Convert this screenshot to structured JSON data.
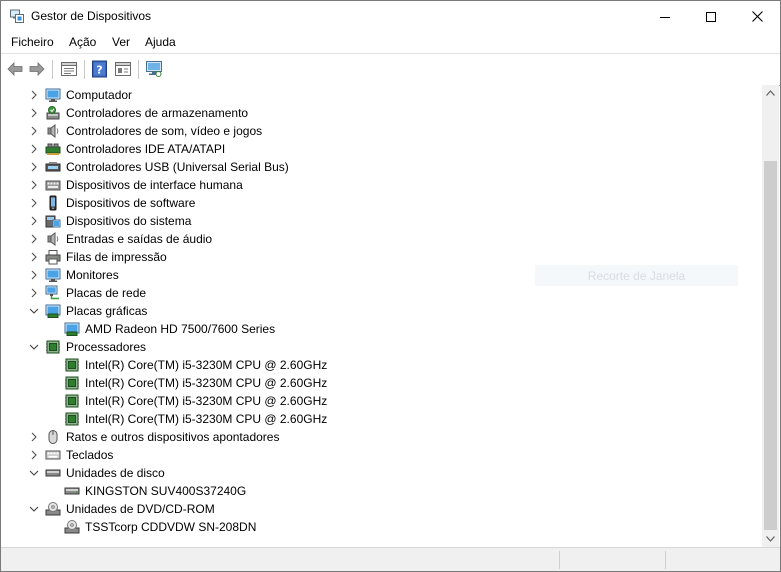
{
  "window": {
    "title": "Gestor de Dispositivos"
  },
  "menu": [
    "Ficheiro",
    "Ação",
    "Ver",
    "Ajuda"
  ],
  "tree": [
    {
      "label": "Computador",
      "icon": "monitor-icon",
      "state": "collapsed",
      "level": 0
    },
    {
      "label": "Controladores de armazenamento",
      "icon": "storage-controller-icon",
      "state": "collapsed",
      "level": 0
    },
    {
      "label": "Controladores de som, vídeo e jogos",
      "icon": "speaker-icon",
      "state": "collapsed",
      "level": 0
    },
    {
      "label": "Controladores IDE ATA/ATAPI",
      "icon": "ide-controller-icon",
      "state": "collapsed",
      "level": 0
    },
    {
      "label": "Controladores USB (Universal Serial Bus)",
      "icon": "usb-icon",
      "state": "collapsed",
      "level": 0
    },
    {
      "label": "Dispositivos de interface humana",
      "icon": "hid-icon",
      "state": "collapsed",
      "level": 0
    },
    {
      "label": "Dispositivos de software",
      "icon": "software-device-icon",
      "state": "collapsed",
      "level": 0
    },
    {
      "label": "Dispositivos do sistema",
      "icon": "system-device-icon",
      "state": "collapsed",
      "level": 0
    },
    {
      "label": "Entradas e saídas de áudio",
      "icon": "speaker-icon",
      "state": "collapsed",
      "level": 0
    },
    {
      "label": "Filas de impressão",
      "icon": "printer-icon",
      "state": "collapsed",
      "level": 0
    },
    {
      "label": "Monitores",
      "icon": "monitor-icon",
      "state": "collapsed",
      "level": 0
    },
    {
      "label": "Placas de rede",
      "icon": "network-icon",
      "state": "collapsed",
      "level": 0
    },
    {
      "label": "Placas gráficas",
      "icon": "display-adapter-icon",
      "state": "expanded",
      "level": 0
    },
    {
      "label": "AMD Radeon HD 7500/7600 Series",
      "icon": "display-adapter-icon",
      "state": "leaf",
      "level": 1
    },
    {
      "label": "Processadores",
      "icon": "cpu-icon",
      "state": "expanded",
      "level": 0
    },
    {
      "label": "Intel(R) Core(TM) i5-3230M CPU @ 2.60GHz",
      "icon": "cpu-icon",
      "state": "leaf",
      "level": 1
    },
    {
      "label": "Intel(R) Core(TM) i5-3230M CPU @ 2.60GHz",
      "icon": "cpu-icon",
      "state": "leaf",
      "level": 1
    },
    {
      "label": "Intel(R) Core(TM) i5-3230M CPU @ 2.60GHz",
      "icon": "cpu-icon",
      "state": "leaf",
      "level": 1
    },
    {
      "label": "Intel(R) Core(TM) i5-3230M CPU @ 2.60GHz",
      "icon": "cpu-icon",
      "state": "leaf",
      "level": 1
    },
    {
      "label": "Ratos e outros dispositivos apontadores",
      "icon": "mouse-icon",
      "state": "collapsed",
      "level": 0
    },
    {
      "label": "Teclados",
      "icon": "keyboard-icon",
      "state": "collapsed",
      "level": 0
    },
    {
      "label": "Unidades de disco",
      "icon": "disk-drive-icon",
      "state": "expanded",
      "level": 0
    },
    {
      "label": "KINGSTON SUV400S37240G",
      "icon": "disk-drive-icon",
      "state": "leaf",
      "level": 1
    },
    {
      "label": "Unidades de DVD/CD-ROM",
      "icon": "dvd-drive-icon",
      "state": "expanded",
      "level": 0
    },
    {
      "label": "TSSTcorp CDDVDW SN-208DN",
      "icon": "dvd-drive-icon",
      "state": "leaf",
      "level": 1
    }
  ],
  "overlay": {
    "ghost_label": "Recorte de Janela"
  },
  "colors": {
    "accent": "#1e88d6",
    "selection": "#cce8ff",
    "cpu_green": "#2f7d2f"
  }
}
